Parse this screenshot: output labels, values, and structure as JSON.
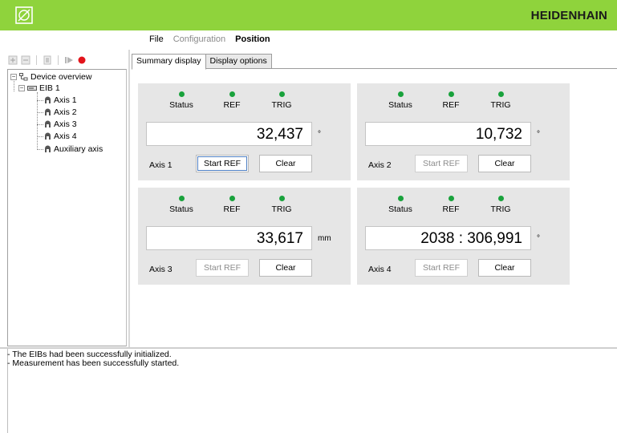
{
  "app": {
    "brand": "HEIDENHAIN",
    "accent_color": "#8fd33c",
    "led_color": "#19a23c"
  },
  "menu": {
    "items": [
      {
        "label": "File",
        "state": "normal"
      },
      {
        "label": "Configuration",
        "state": "disabled"
      },
      {
        "label": "Position",
        "state": "active"
      }
    ]
  },
  "toolbar": {
    "icons": [
      "add-icon",
      "remove-icon",
      "properties-icon",
      "play-icon",
      "record-icon"
    ]
  },
  "tree": {
    "root": "Device overview",
    "device": "EIB 1",
    "axes": [
      "Axis 1",
      "Axis 2",
      "Axis 3",
      "Axis 4",
      "Auxiliary axis"
    ]
  },
  "tabs": [
    {
      "label": "Summary display",
      "active": true
    },
    {
      "label": "Display options",
      "active": false
    }
  ],
  "indicators": {
    "status": "Status",
    "ref": "REF",
    "trig": "TRIG"
  },
  "buttons": {
    "start_ref": "Start REF",
    "clear": "Clear"
  },
  "axes": [
    {
      "name": "Axis 1",
      "value": "32,437",
      "unit": "°",
      "start_ref_enabled": true
    },
    {
      "name": "Axis 2",
      "value": "10,732",
      "unit": "°",
      "start_ref_enabled": false
    },
    {
      "name": "Axis 3",
      "value": "33,617",
      "unit": "mm",
      "start_ref_enabled": false
    },
    {
      "name": "Axis 4",
      "value": "2038 : 306,991",
      "unit": "°",
      "start_ref_enabled": false
    }
  ],
  "log": [
    "- The EIBs had been successfully initialized.",
    "- Measurement has been successfully started."
  ]
}
